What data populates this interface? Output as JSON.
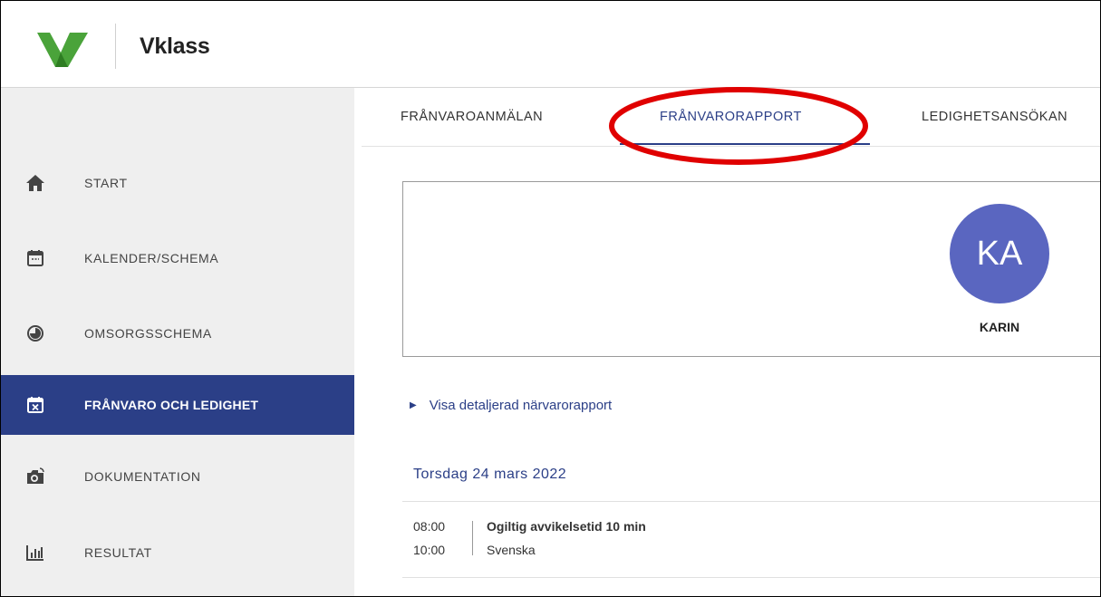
{
  "header": {
    "app_name": "Vklass"
  },
  "sidebar": {
    "items": [
      {
        "label": "START",
        "icon": "home-icon"
      },
      {
        "label": "KALENDER/SCHEMA",
        "icon": "calendar-icon"
      },
      {
        "label": "OMSORGSSCHEMA",
        "icon": "clock-icon"
      },
      {
        "label": "FRÅNVARO OCH LEDIGHET",
        "icon": "calendar-x-icon",
        "active": true
      },
      {
        "label": "DOKUMENTATION",
        "icon": "camera-icon"
      },
      {
        "label": "RESULTAT",
        "icon": "bar-chart-icon"
      }
    ]
  },
  "tabs": [
    {
      "label": "FRÅNVAROANMÄLAN"
    },
    {
      "label": "FRÅNVARORAPPORT",
      "active": true
    },
    {
      "label": "LEDIGHETSANSÖKAN"
    }
  ],
  "student": {
    "initials": "KA",
    "name": "KARIN"
  },
  "report": {
    "details_link": "Visa detaljerad närvarorapport",
    "day": "Torsdag 24 mars 2022",
    "entry": {
      "start": "08:00",
      "end": "10:00",
      "title": "Ogiltig avvikelsetid 10 min",
      "subject": "Svenska"
    }
  },
  "colors": {
    "accent": "#2b3f87",
    "avatar": "#5a66c0",
    "highlight": "#e00000",
    "logo_green": "#4aa33a"
  }
}
